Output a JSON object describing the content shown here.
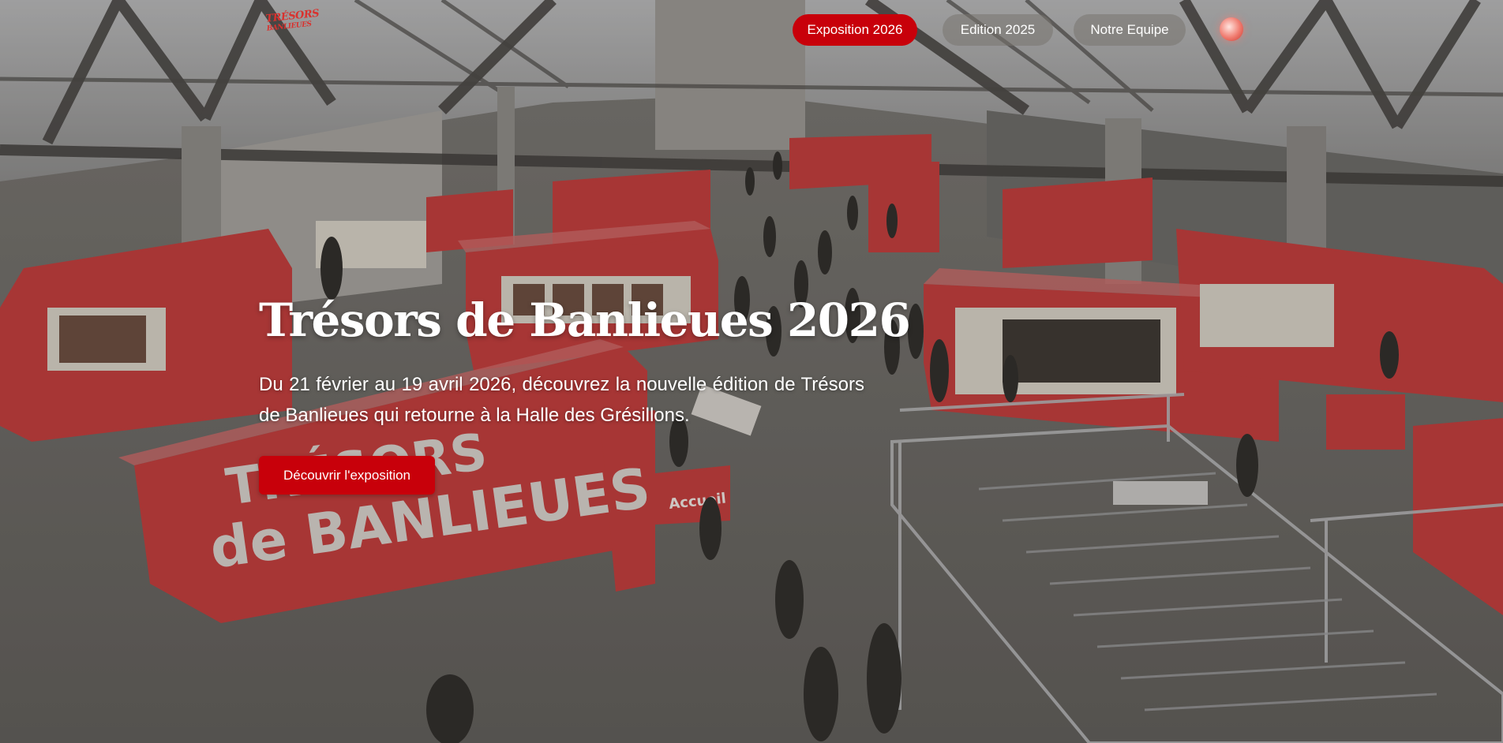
{
  "logo": {
    "line1": "TRÉSORS",
    "line2": "BANLIEUES"
  },
  "nav": {
    "items": [
      {
        "label": "Exposition 2026",
        "active": true
      },
      {
        "label": "Edition 2025",
        "active": false
      },
      {
        "label": "Notre Equipe",
        "active": false
      }
    ]
  },
  "hero": {
    "title": "Trésors de Banlieues 2026",
    "description": "Du 21 février au 19 avril 2026, découvrez la nouvelle édition de Trésors de Banlieues qui retourne à la Halle des Grésillons.",
    "cta_label": "Découvrir l'exposition",
    "container_lettering": "TRÉSORS de BANLIEUES",
    "sign_lettering": "Accueil"
  },
  "colors": {
    "accent": "#c8000a",
    "container_red": "#c43a3a",
    "text": "#ffffff"
  },
  "icons": {
    "logo": "tresors-logo-icon",
    "theme_toggle": "moon-icon"
  }
}
